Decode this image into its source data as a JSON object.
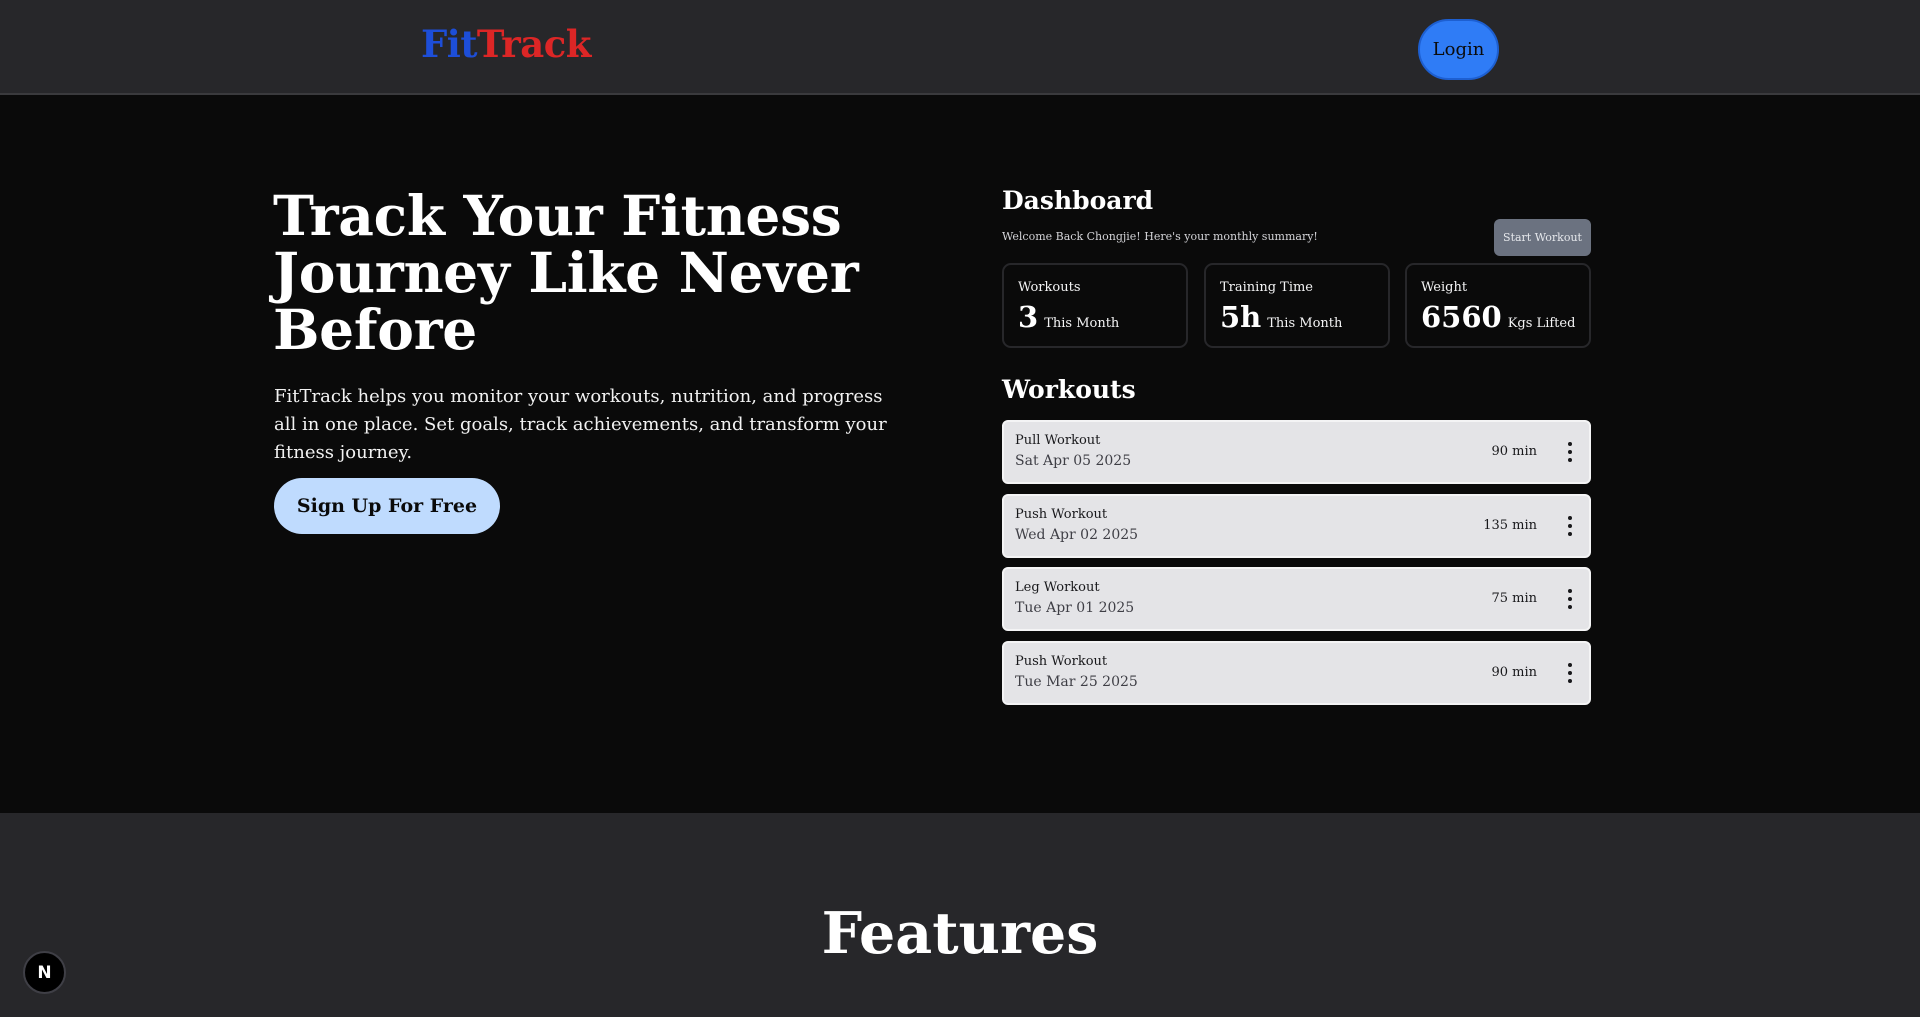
{
  "nav": {
    "logo_part1": "Fit",
    "logo_part2": "Track",
    "login_label": "Login"
  },
  "hero": {
    "title": "Track Your Fitness Journey Like Never Before",
    "description": "FitTrack helps you monitor your workouts, nutrition, and progress all in one place. Set goals, track achievements, and transform your fitness journey.",
    "cta_label": "Sign Up For Free"
  },
  "dashboard": {
    "title": "Dashboard",
    "subtitle": "Welcome Back Chongjie! Here's your monthly summary!",
    "start_label": "Start Workout",
    "stats": [
      {
        "label": "Workouts",
        "value": "3",
        "unit": "This Month"
      },
      {
        "label": "Training Time",
        "value": "5h",
        "unit": "This Month"
      },
      {
        "label": "Weight",
        "value": "6560",
        "unit": "Kgs Lifted"
      }
    ],
    "workouts_title": "Workouts",
    "workouts": [
      {
        "name": "Pull Workout",
        "date": "Sat Apr 05 2025",
        "duration": "90 min"
      },
      {
        "name": "Push Workout",
        "date": "Wed Apr 02 2025",
        "duration": "135 min"
      },
      {
        "name": "Leg Workout",
        "date": "Tue Apr 01 2025",
        "duration": "75 min"
      },
      {
        "name": "Push Workout",
        "date": "Tue Mar 25 2025",
        "duration": "90 min"
      }
    ]
  },
  "features": {
    "title": "Features"
  },
  "badge": {
    "letter": "N"
  },
  "colors": {
    "logo_fit": "#1d4ed8",
    "logo_track": "#dc2626",
    "login_bg": "#2f7cf6",
    "signup_bg": "#bfdbfe",
    "start_bg": "#6b7280",
    "workout_card_bg": "#e4e4e7"
  }
}
